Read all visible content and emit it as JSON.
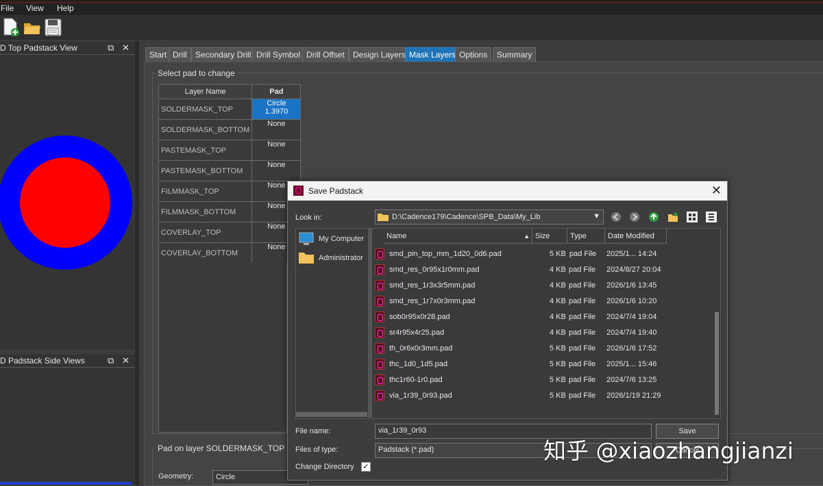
{
  "menu": [
    "File",
    "View",
    "Help"
  ],
  "toolbar": {
    "icons": [
      "new-file-icon",
      "open-folder-icon",
      "save-disk-icon"
    ]
  },
  "top_view": {
    "title": "D Top Padstack View",
    "outer_color": "#0000ff",
    "inner_color": "#ff0000"
  },
  "side_view": {
    "title": "D Padstack Side Views"
  },
  "tabs": [
    "Start",
    "Drill",
    "Secondary Drill",
    "Drill Symbol",
    "Drill Offset",
    "Design Layers",
    "Mask Layers",
    "Options",
    "Summary"
  ],
  "active_tab": "Mask Layers",
  "select_pad": {
    "group_label": "Select pad to change",
    "headers": {
      "layer": "Layer Name",
      "pad": "Pad"
    },
    "rows": [
      {
        "layer": "SOLDERMASK_TOP",
        "pad": "Circle 1.3970"
      },
      {
        "layer": "SOLDERMASK_BOTTOM",
        "pad": "None"
      },
      {
        "layer": "PASTEMASK_TOP",
        "pad": "None"
      },
      {
        "layer": "PASTEMASK_BOTTOM",
        "pad": "None"
      },
      {
        "layer": "FILMMASK_TOP",
        "pad": "None"
      },
      {
        "layer": "FILMMASK_BOTTOM",
        "pad": "None"
      },
      {
        "layer": "COVERLAY_TOP",
        "pad": "None"
      },
      {
        "layer": "COVERLAY_BOTTOM",
        "pad": "None"
      }
    ]
  },
  "pad_on_layer": {
    "group_label": "Pad on layer SOLDERMASK_TOP",
    "geometry_label": "Geometry:",
    "geometry_value": "Circle"
  },
  "dialog": {
    "title": "Save Padstack",
    "look_in_label": "Look in:",
    "look_in_path": "D:\\Cadence179\\Cadence\\SPB_Data\\My_Lib",
    "places": [
      "My Computer",
      "Administrator"
    ],
    "columns": {
      "name": "Name",
      "size": "Size",
      "type": "Type",
      "date": "Date Modified"
    },
    "files": [
      {
        "name": "smd_pin_top_mm_1d20_0d6.pad",
        "size": "",
        "type": "",
        "date": "2025/1... 14:24"
      },
      {
        "name": "smd_res_0r95x1r0mm.pad",
        "size": "4 KB",
        "type": "pad File",
        "date": "2024/8/27 20:04"
      },
      {
        "name": "smd_res_1r3x3r5mm.pad",
        "size": "4 KB",
        "type": "pad File",
        "date": "2026/1/6 13:45"
      },
      {
        "name": "smd_res_1r7x0r3mm.pad",
        "size": "4 KB",
        "type": "pad File",
        "date": "2026/1/6 10:20"
      },
      {
        "name": "sob0r95x0r28.pad",
        "size": "4 KB",
        "type": "pad File",
        "date": "2024/7/4 19:04"
      },
      {
        "name": "sr4r95x4r25.pad",
        "size": "4 KB",
        "type": "pad File",
        "date": "2024/7/4 19:40"
      },
      {
        "name": "th_0r6x0r3mm.pad",
        "size": "5 KB",
        "type": "pad File",
        "date": "2026/1/6 17:52"
      },
      {
        "name": "thc_1d0_1d5.pad",
        "size": "5 KB",
        "type": "pad File",
        "date": "2025/1... 15:46"
      },
      {
        "name": "thc1r60-1r0.pad",
        "size": "5 KB",
        "type": "pad File",
        "date": "2024/7/6 13:25"
      },
      {
        "name": "via_1r39_0r93.pad",
        "size": "5 KB",
        "type": "pad File",
        "date": "2026/1/19 21:29"
      }
    ],
    "partial_row": {
      "size": "5 KB",
      "type": "pad File"
    },
    "file_name_label": "File name:",
    "file_name_value": "via_1r39_0r93",
    "file_type_label": "Files of type:",
    "file_type_value": "Padstack (*.pad)",
    "save_label": "Save",
    "cancel_label": "Cancel",
    "change_dir_label": "Change Directory",
    "change_dir_checked": true
  },
  "watermark": "知乎 @xiaozhangjianzi"
}
